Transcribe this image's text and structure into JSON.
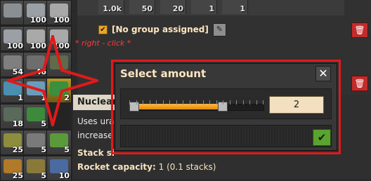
{
  "annotation": {
    "right_click_text": "* right - click *"
  },
  "inventory": {
    "slots": [
      {
        "col": 0,
        "row": 0,
        "count": "",
        "color": "#8b8f94"
      },
      {
        "col": 1,
        "row": 0,
        "count": "100",
        "color": "#9aa0a6"
      },
      {
        "col": 2,
        "row": 0,
        "count": "100",
        "color": "#a8a8a8"
      },
      {
        "col": 0,
        "row": 1,
        "count": "100",
        "color": "#9aa0a6"
      },
      {
        "col": 1,
        "row": 1,
        "count": "100",
        "color": "#a9a9a9"
      },
      {
        "col": 2,
        "row": 1,
        "count": "100",
        "color": "#a9a9a9"
      },
      {
        "col": 0,
        "row": 2,
        "count": "54",
        "color": "#7f7f7f"
      },
      {
        "col": 1,
        "row": 2,
        "count": "46",
        "color": "#6e6e6e"
      },
      {
        "col": 2,
        "row": 2,
        "count": "",
        "color": "#5f6b4a"
      },
      {
        "col": 0,
        "row": 3,
        "count": "1",
        "color": "#4b8fb0"
      },
      {
        "col": 1,
        "row": 3,
        "count": "1",
        "color": "#6b9dbb"
      },
      {
        "col": 2,
        "row": 3,
        "count": "2",
        "color": "#3c8f3c",
        "selected": true
      },
      {
        "col": 0,
        "row": 4,
        "count": "18",
        "color": "#5a6a5a"
      },
      {
        "col": 1,
        "row": 4,
        "count": "5",
        "color": "#3d8a3d"
      },
      {
        "col": 0,
        "row": 5,
        "count": "25",
        "color": "#8d8d3d"
      },
      {
        "col": 1,
        "row": 5,
        "count": "5",
        "color": "#7a7a7a"
      },
      {
        "col": 2,
        "row": 5,
        "count": "5",
        "color": "#5a9a3a"
      },
      {
        "col": 0,
        "row": 6,
        "count": "25",
        "color": "#b07a2a"
      },
      {
        "col": 1,
        "row": 6,
        "count": "5",
        "color": "#8a7a3a"
      },
      {
        "col": 2,
        "row": 6,
        "count": "10",
        "color": "#4a6aa0"
      }
    ]
  },
  "top_row": [
    "1.0k",
    "50",
    "20",
    "1",
    "1"
  ],
  "group": {
    "label": "[No group assigned]",
    "checked": true
  },
  "tooltip": {
    "title": "Nuclear",
    "line1": "Uses ura",
    "line2": "increase",
    "stack_label": "Stack si",
    "rocket_label": "Rocket capacity:",
    "rocket_value": "1 (0.1 stacks)"
  },
  "dialog": {
    "title": "Select amount",
    "close_label": "✕",
    "amount_value": "2",
    "slider_fraction": 0.7,
    "confirm_label": "✔"
  },
  "colors": {
    "accent_orange": "#e48a00",
    "annotation_red": "#e01a1a",
    "confirm_green": "#5aa32f",
    "trash_red": "#c42b2b"
  }
}
